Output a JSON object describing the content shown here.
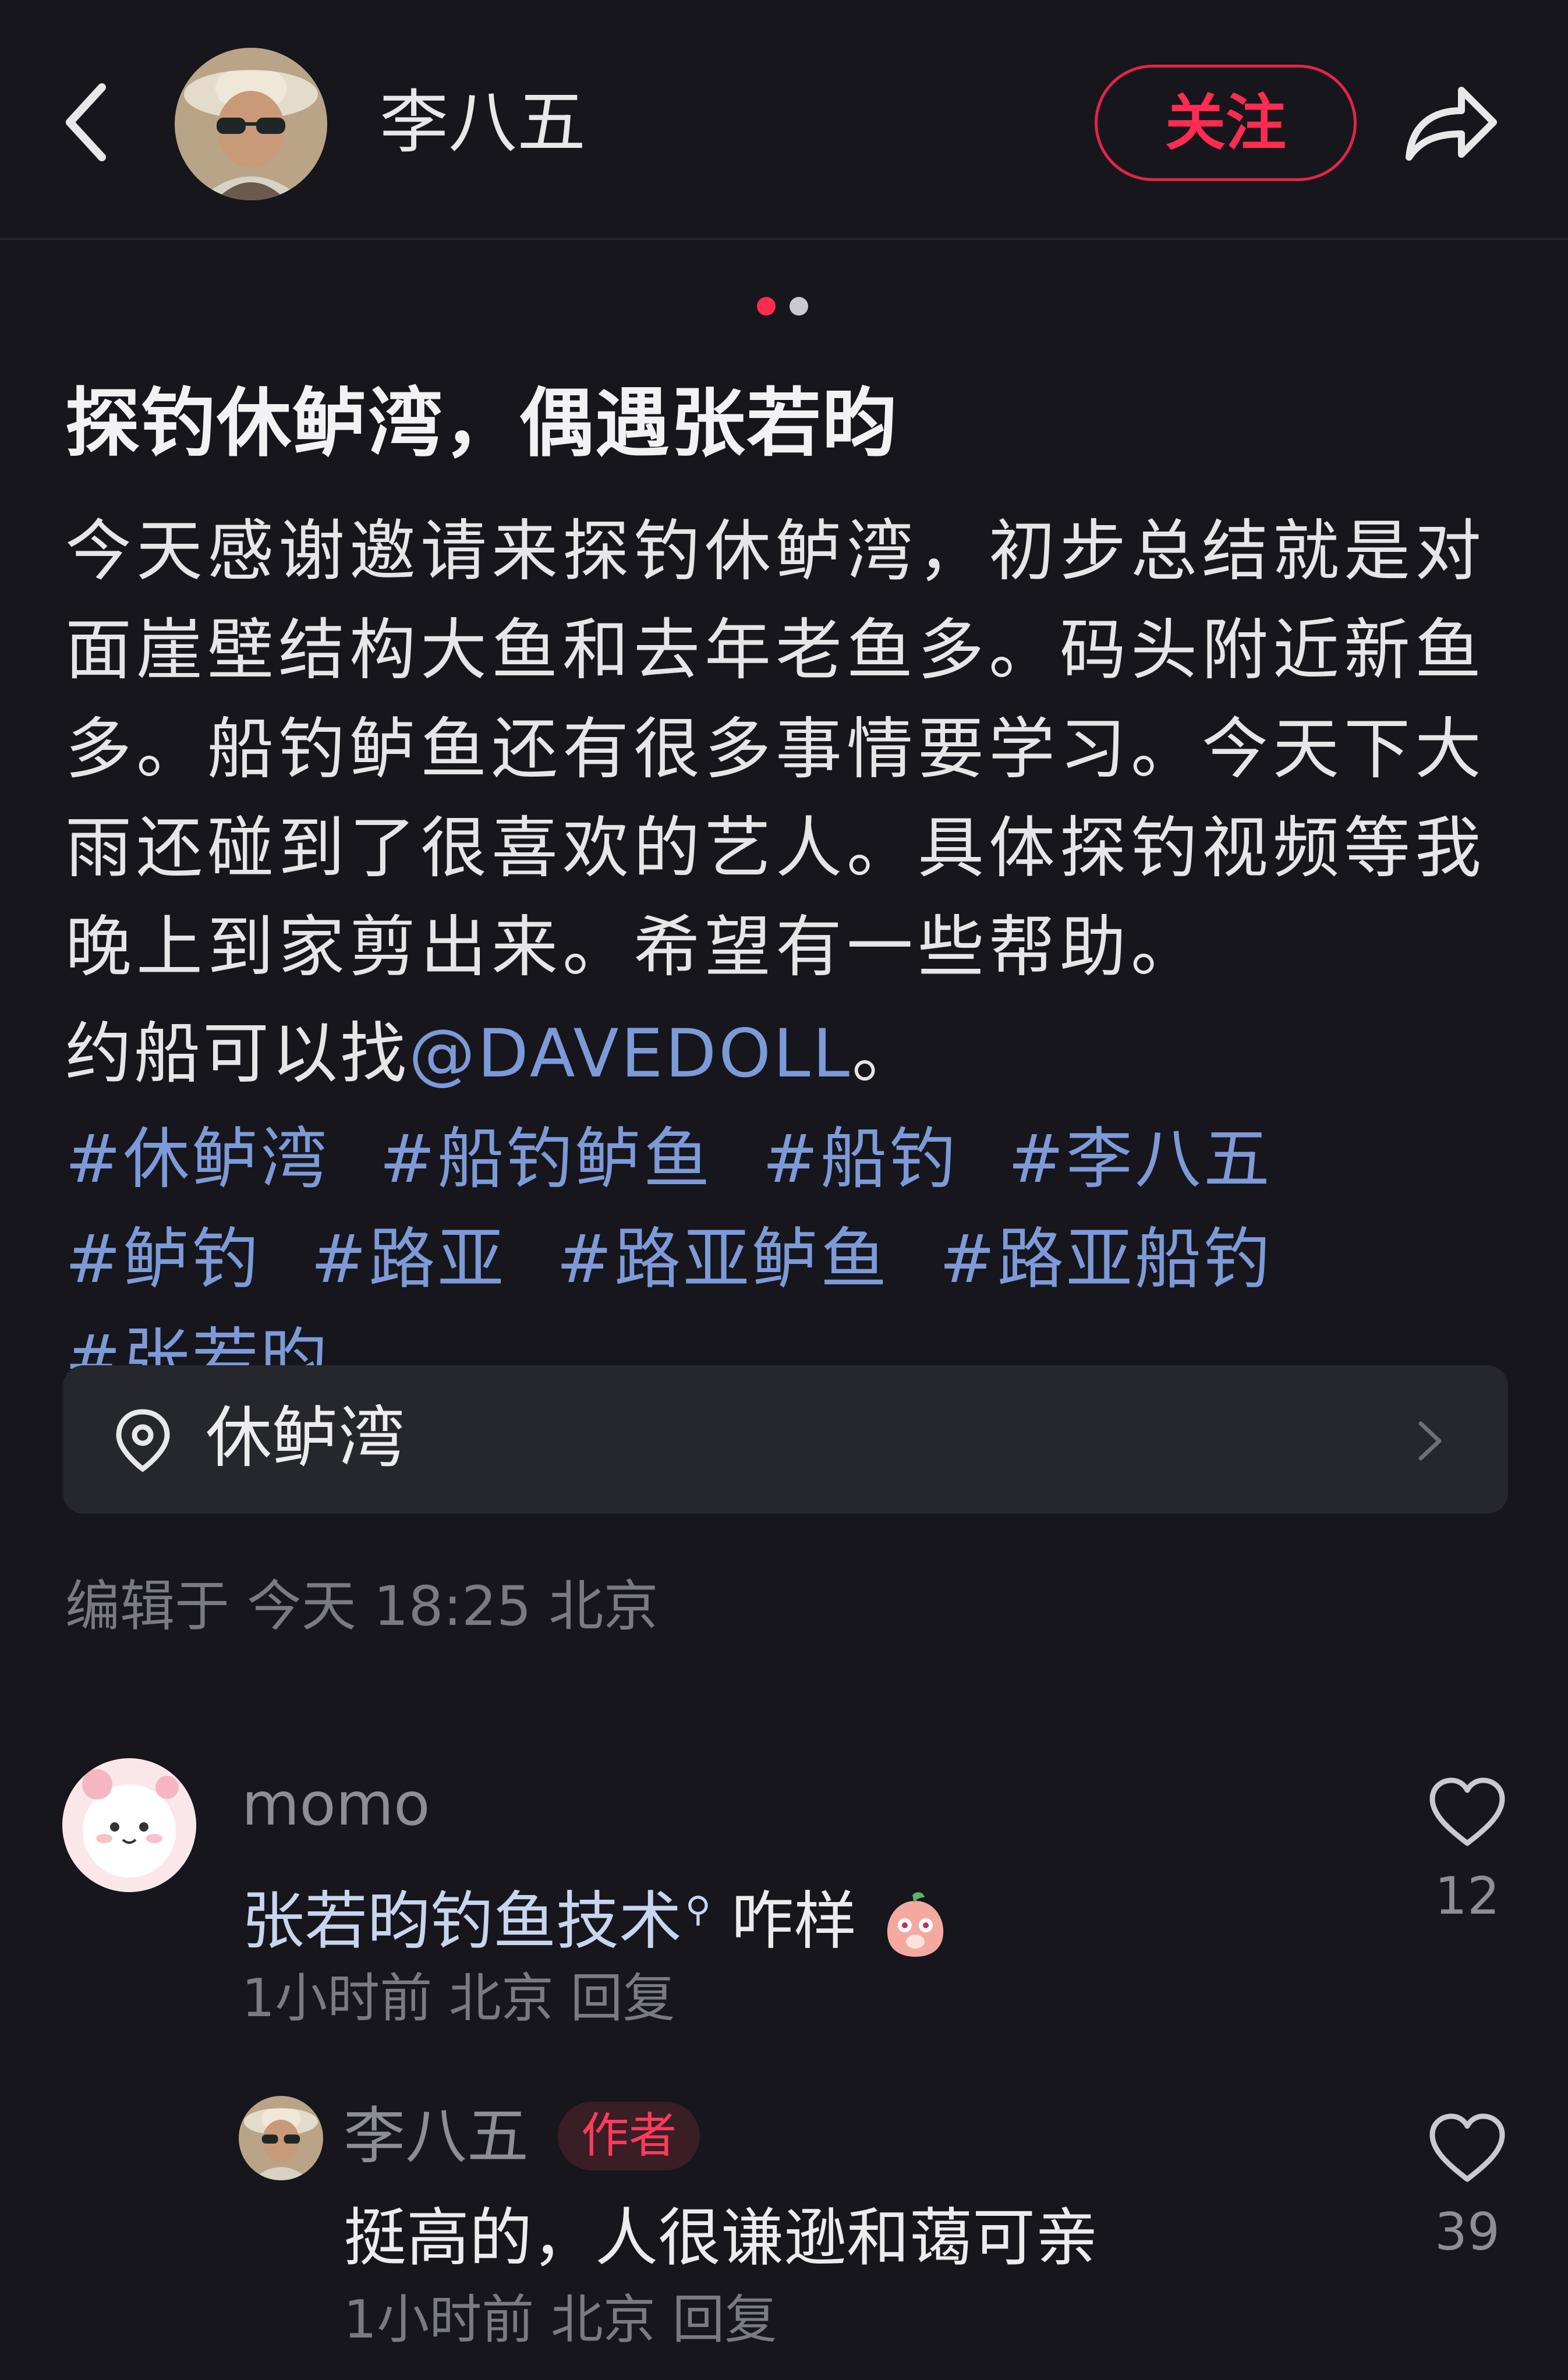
{
  "header": {
    "author": "李八五",
    "follow_label": "关注"
  },
  "carousel": {
    "total": 2,
    "active": 1
  },
  "post": {
    "title": "探钓休鲈湾，偶遇张若昀",
    "body": "今天感谢邀请来探钓休鲈湾，初步总结就是对面崖壁结构大鱼和去年老鱼多。码头附近新鱼多。船钓鲈鱼还有很多事情要学习。今天下大雨还碰到了很喜欢的艺人。具体探钓视频等我晚上到家剪出来。希望有一些帮助。",
    "boat_prefix": "约船可以找",
    "mention": "@DAVEDOLL",
    "boat_suffix": "。",
    "tags": [
      "#休鲈湾",
      "#船钓鲈鱼",
      "#船钓",
      "#李八五",
      "#鲈钓",
      "#路亚",
      "#路亚鲈鱼",
      "#路亚船钓",
      "#张若昀"
    ],
    "location": "休鲈湾",
    "edited": "编辑于 今天 18:25 北京"
  },
  "comments": [
    {
      "user": "momo",
      "text": "张若昀钓鱼技术",
      "text_suffix": " 咋样",
      "meta": "1小时前 北京 回复",
      "likes": "12"
    },
    {
      "user": "李八五",
      "badge": "作者",
      "text": "挺高的，人很谦逊和蔼可亲",
      "meta": "1小时前 北京 回复",
      "likes": "39"
    }
  ],
  "colors": {
    "background": "#16161c",
    "accent": "#ff2b50",
    "link": "#7d9ad8",
    "card": "#26262d"
  },
  "icons": [
    "back-arrow-icon",
    "share-icon",
    "location-pin-icon",
    "chevron-right-icon",
    "heart-icon",
    "search-icon",
    "blushing-emoji-icon"
  ]
}
